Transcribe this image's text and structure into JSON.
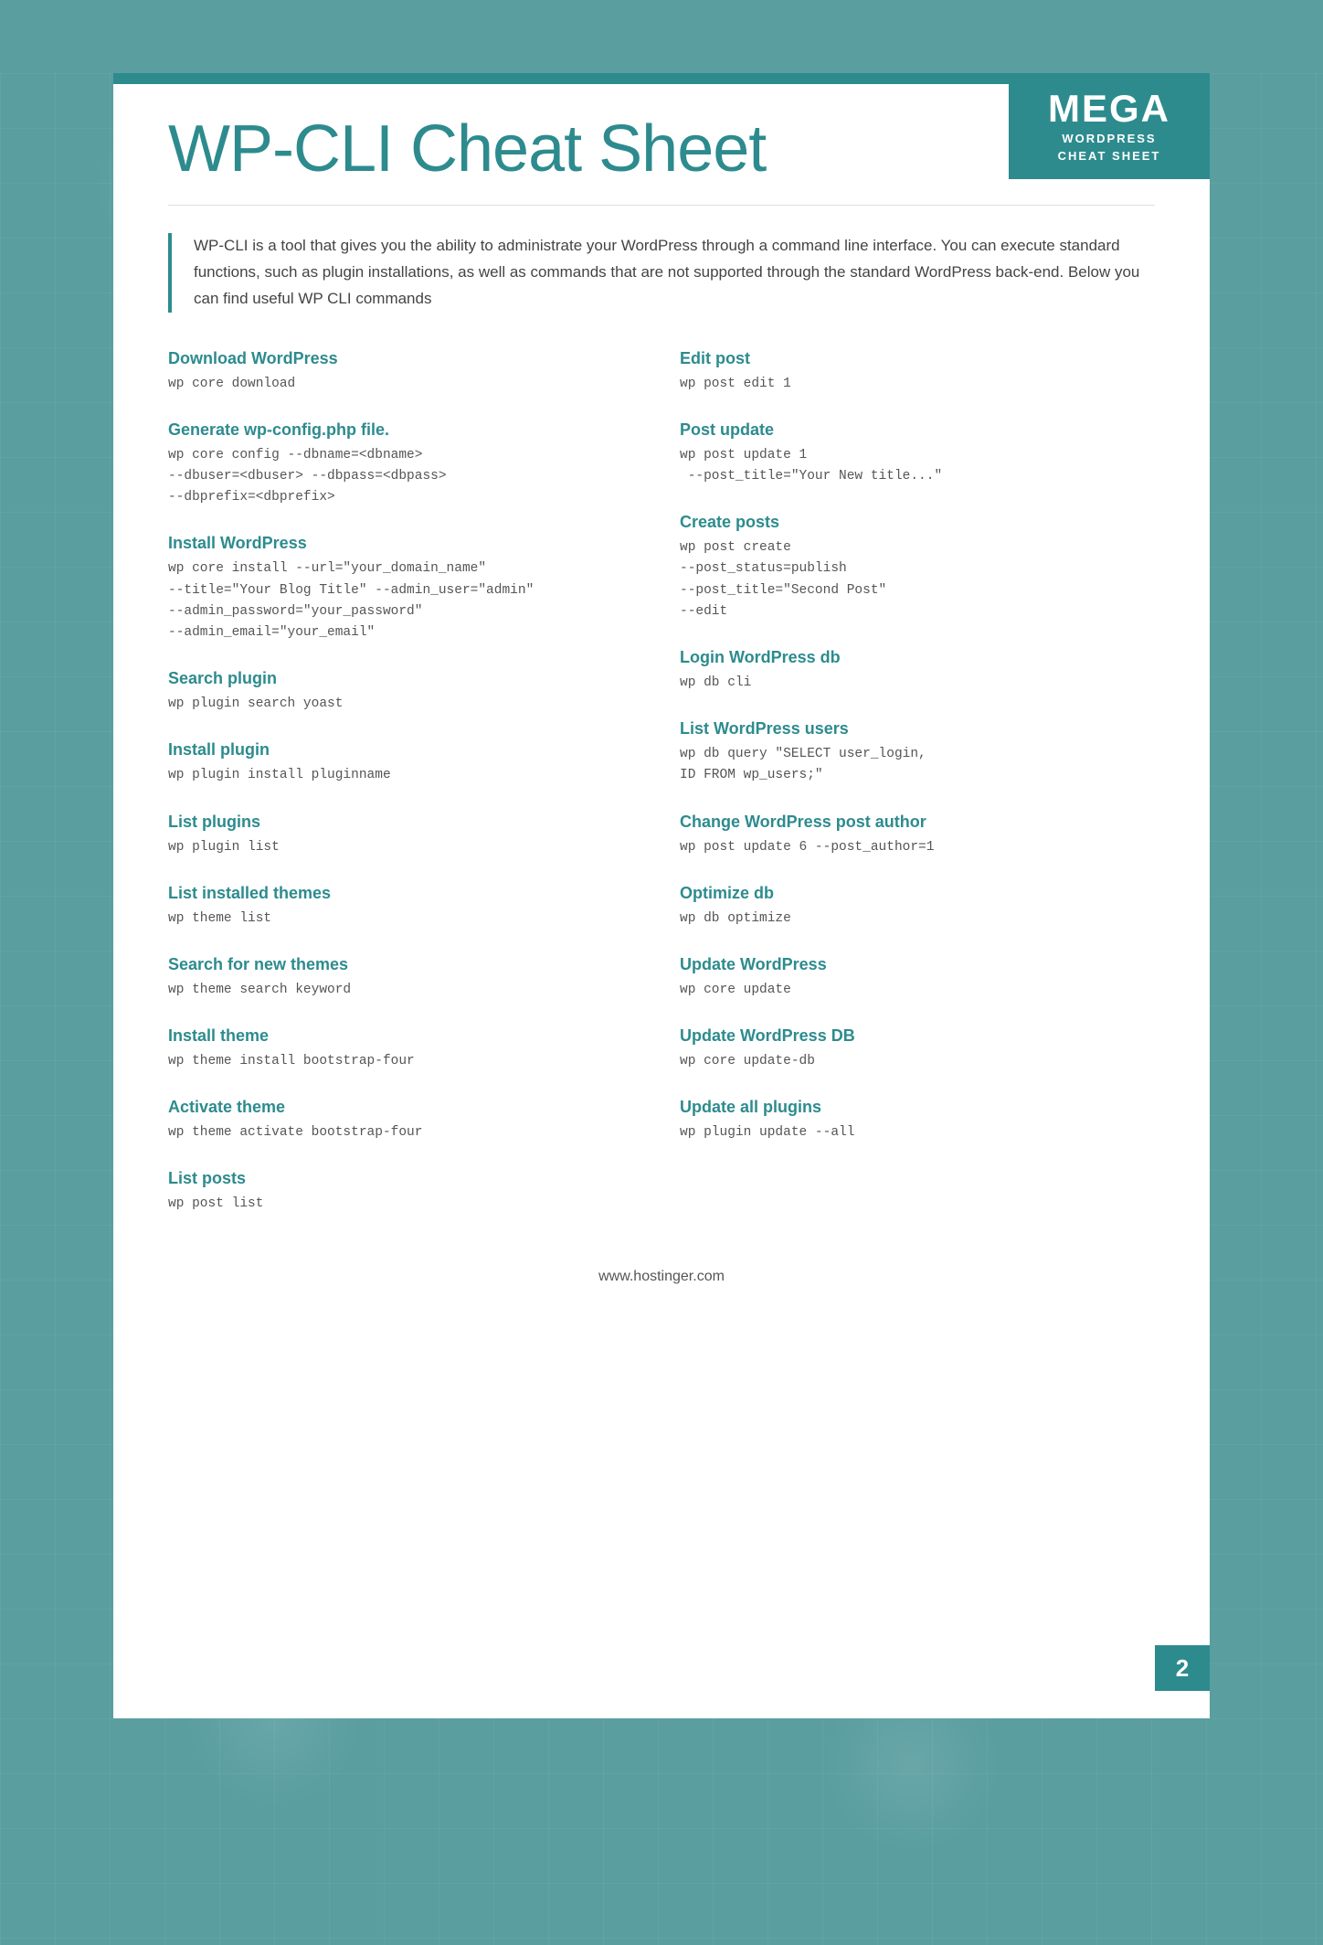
{
  "background": {
    "color": "#5a9ea0"
  },
  "logo": {
    "mega": "MEGA",
    "line1": "WORDPRESS",
    "line2": "CHEAT SHEET"
  },
  "main_title": "WP-CLI Cheat Sheet",
  "intro": "WP-CLI is a tool that gives you the ability to administrate your WordPress through a command line interface. You can execute standard functions, such as plugin installations, as well as commands that are not supported through the standard WordPress back-end. Below you can find useful WP CLI commands",
  "left_commands": [
    {
      "title": "Download WordPress",
      "code": "wp core download"
    },
    {
      "title": "Generate wp-config.php file.",
      "code": "wp core config --dbname=<dbname>\n--dbuser=<dbuser> --dbpass=<dbpass>\n--dbprefix=<dbprefix>"
    },
    {
      "title": "Install WordPress",
      "code": "wp core install --url=\"your_domain_name\"\n--title=\"Your Blog Title\" --admin_user=\"admin\"\n--admin_password=\"your_password\"\n--admin_email=\"your_email\""
    },
    {
      "title": "Search plugin",
      "code": "wp plugin search yoast"
    },
    {
      "title": "Install plugin",
      "code": "wp plugin install pluginname"
    },
    {
      "title": "List plugins",
      "code": "wp plugin list"
    },
    {
      "title": "List installed themes",
      "code": "wp theme list"
    },
    {
      "title": "Search for new themes",
      "code": "wp theme search keyword"
    },
    {
      "title": "Install theme",
      "code": "wp theme install bootstrap-four"
    },
    {
      "title": "Activate theme",
      "code": "wp theme activate bootstrap-four"
    },
    {
      "title": "List posts",
      "code": "wp post list"
    }
  ],
  "right_commands": [
    {
      "title": "Edit post",
      "code": "wp post edit 1"
    },
    {
      "title": "Post update",
      "code": "wp post update 1\n --post_title=\"Your New title...\""
    },
    {
      "title": "Create posts",
      "code": "wp post create\n--post_status=publish\n--post_title=\"Second Post\"\n--edit"
    },
    {
      "title": "Login WordPress db",
      "code": "wp db cli"
    },
    {
      "title": "List WordPress users",
      "code": "wp db query \"SELECT user_login,\nID FROM wp_users;\""
    },
    {
      "title": "Change WordPress post author",
      "code": "wp post update 6 --post_author=1"
    },
    {
      "title": "Optimize db",
      "code": "wp db optimize"
    },
    {
      "title": "Update WordPress",
      "code": "wp core update"
    },
    {
      "title": "Update WordPress DB",
      "code": "wp core update-db"
    },
    {
      "title": "Update all plugins",
      "code": "wp plugin update --all"
    }
  ],
  "footer": {
    "url": "www.hostinger.com"
  },
  "page_number": "2"
}
